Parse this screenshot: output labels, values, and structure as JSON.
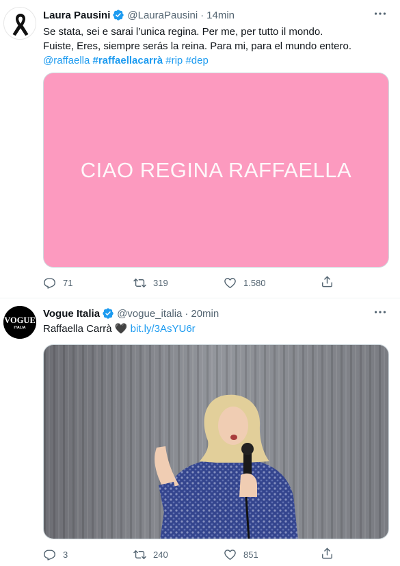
{
  "tweets": [
    {
      "name": "Laura Pausini",
      "handle": "@LauraPausini",
      "separator": "·",
      "time": "14min",
      "text_line1": "Se stata, sei e sarai l’unica regina. Per me, per tutto il mondo.",
      "text_line2": "Fuiste, Eres, siempre serás la reina. Para mi, para el mundo entero.",
      "mention": "@raffaella",
      "hashtag_bold": "#raffaellacarrà",
      "hashtag_rip": "#rip",
      "hashtag_dep": "#dep",
      "media_text": "CIAO REGINA RAFFAELLA",
      "replies": "71",
      "retweets": "319",
      "likes": "1.580"
    },
    {
      "name": "Vogue Italia",
      "handle": "@vogue_italia",
      "separator": "·",
      "time": "20min",
      "text": "Raffaella Carrà",
      "emoji": "🖤",
      "link": "bit.ly/3AsYU6r",
      "avatar_logo": "VOGUE",
      "avatar_sub": "ITALIA",
      "replies": "3",
      "retweets": "240",
      "likes": "851"
    }
  ],
  "colors": {
    "accent": "#1d9bf0",
    "secondary_text": "#536471",
    "banner_pink": "#fc9abf"
  },
  "icons": [
    "black-ribbon-icon",
    "verified-badge-icon",
    "more-icon",
    "reply-icon",
    "retweet-icon",
    "like-icon",
    "share-icon"
  ]
}
